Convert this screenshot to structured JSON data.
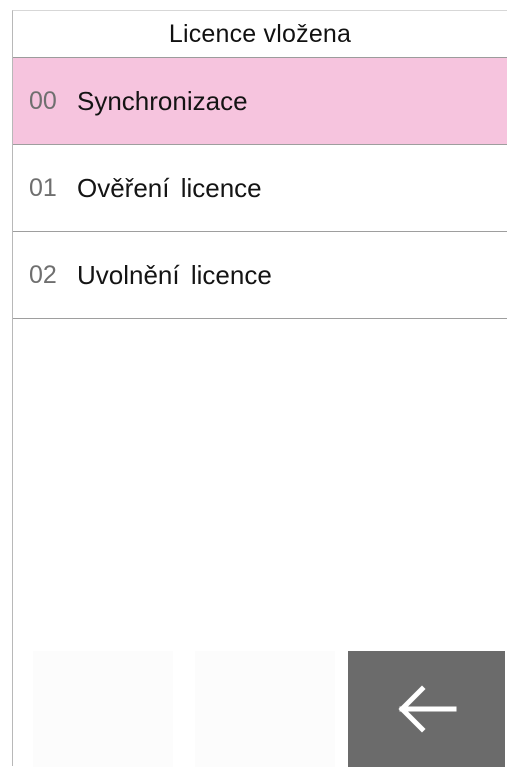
{
  "header": {
    "title": "Licence vložena"
  },
  "menu": {
    "items": [
      {
        "number": "00",
        "label": "Synchronizace",
        "selected": true
      },
      {
        "number": "01",
        "label": "Ověření licence",
        "selected": false
      },
      {
        "number": "02",
        "label": "Uvolnění licence",
        "selected": false
      }
    ]
  },
  "footer": {
    "back_icon": "arrow-left-icon"
  },
  "colors": {
    "selected_row": "#f6c4de",
    "back_button": "#6b6b6b",
    "divider": "#9e9e9e",
    "number_text": "#6f6f6f"
  }
}
